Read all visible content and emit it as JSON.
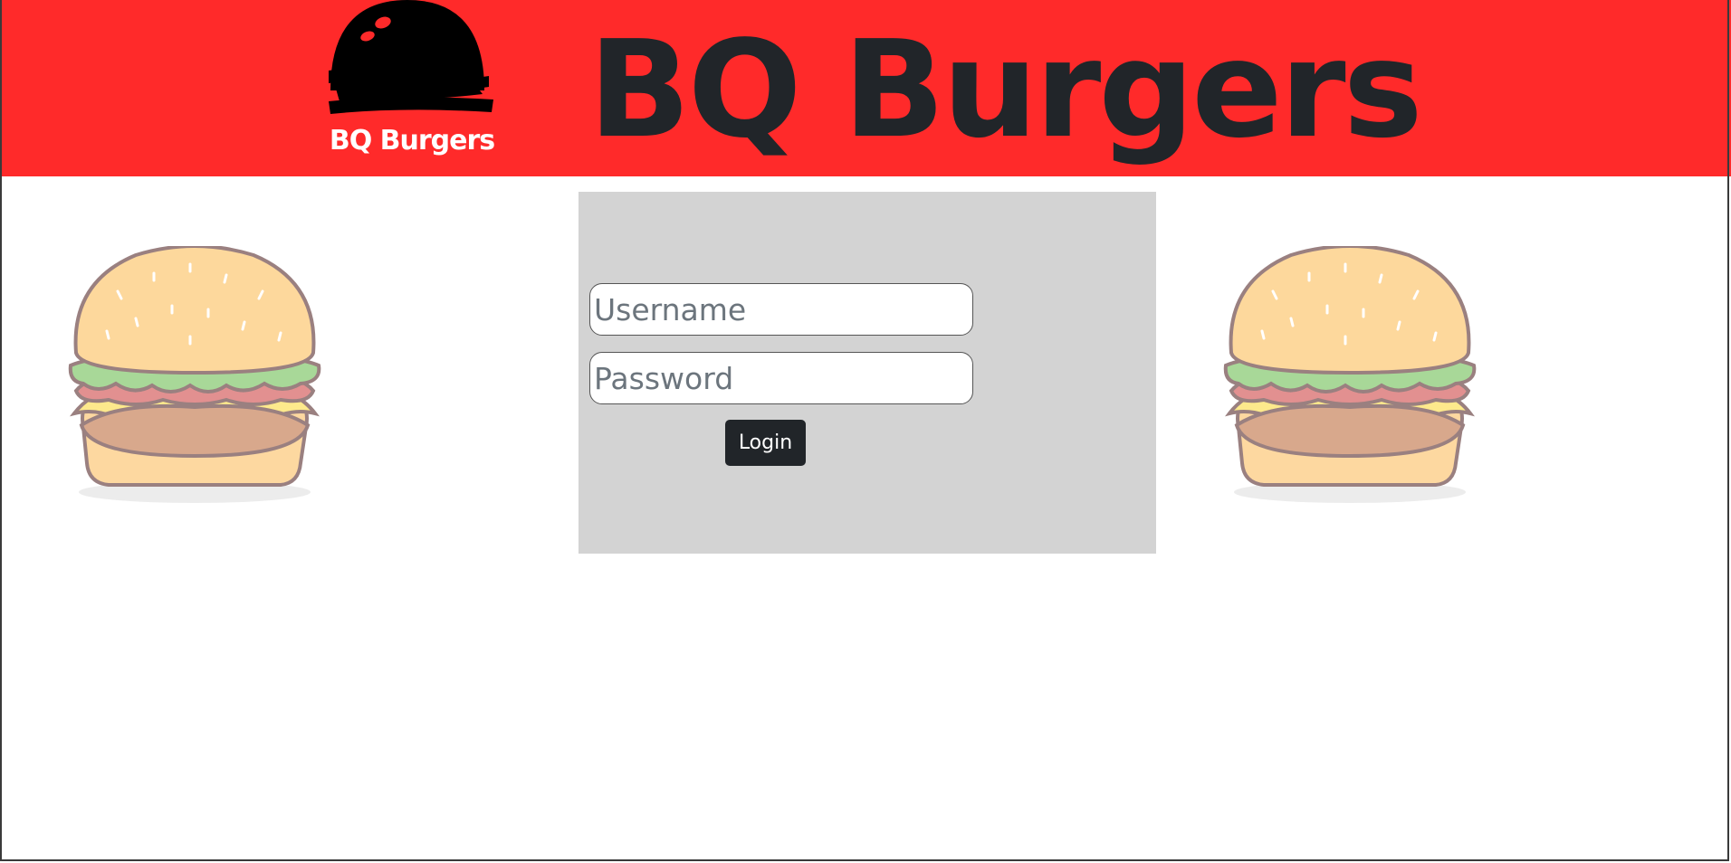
{
  "header": {
    "logo_text": "BQ Burgers",
    "title": "BQ Burgers"
  },
  "login": {
    "username_placeholder": "Username",
    "password_placeholder": "Password",
    "button_label": "Login"
  },
  "colors": {
    "header_bg": "#ff2a2a",
    "panel_bg": "#d3d3d3",
    "button_bg": "#212529",
    "title_text": "#212529"
  },
  "icons": {
    "logo": "burger-logo-icon",
    "left_decoration": "burger-illustration",
    "right_decoration": "burger-illustration"
  }
}
